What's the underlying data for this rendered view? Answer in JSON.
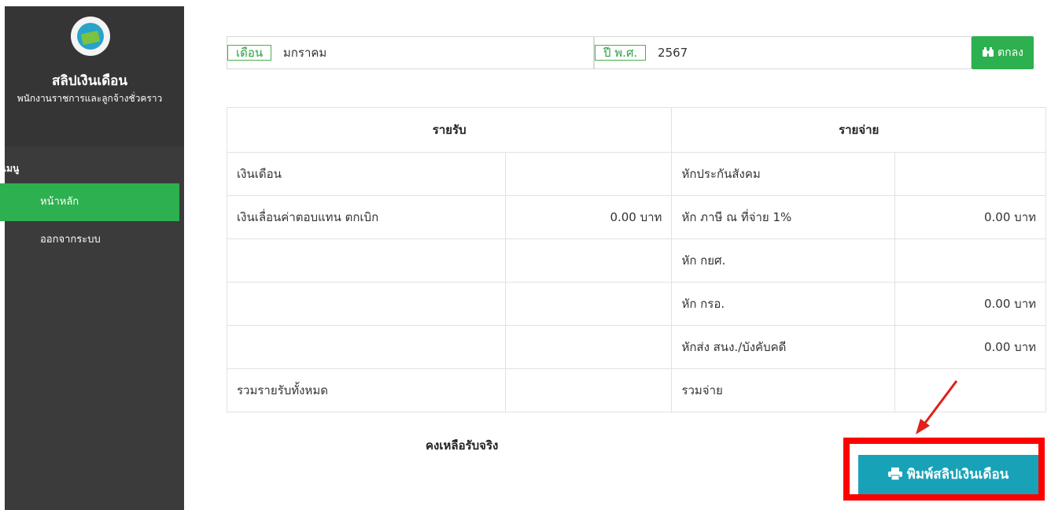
{
  "sidebar": {
    "app_title": "สลิปเงินเดือน",
    "app_subtitle": "พนักงานราชการและลูกจ้างชั่วคราว",
    "menu_header": "เมนู",
    "items": [
      {
        "label": "หน้าหลัก",
        "active": true
      },
      {
        "label": "ออกจากระบบ",
        "active": false
      }
    ]
  },
  "filter": {
    "month_label": "เดือน",
    "month_value": "มกราคม",
    "year_label": "ปี พ.ศ.",
    "year_value": "2567",
    "submit_label": "ตกลง",
    "submit_icon": "binoculars-icon"
  },
  "table": {
    "headers": {
      "income": "รายรับ",
      "expense": "รายจ่าย"
    },
    "rows": [
      {
        "income_label": "เงินเดือน",
        "income_amount": "",
        "expense_label": "หักประกันสังคม",
        "expense_amount": ""
      },
      {
        "income_label": "เงินเลื่อนค่าตอบแทน ตกเบิก",
        "income_amount": "0.00 บาท",
        "expense_label": "หัก ภาษี ณ ที่จ่าย 1%",
        "expense_amount": "0.00 บาท"
      },
      {
        "income_label": "",
        "income_amount": "",
        "expense_label": "หัก กยศ.",
        "expense_amount": ""
      },
      {
        "income_label": "",
        "income_amount": "",
        "expense_label": "หัก กรอ.",
        "expense_amount": "0.00 บาท"
      },
      {
        "income_label": "",
        "income_amount": "",
        "expense_label": "หักส่ง สนง./บังคับคดี",
        "expense_amount": "0.00 บาท"
      },
      {
        "income_label": "รวมรายรับทั้งหมด",
        "income_amount": "",
        "expense_label": "รวมจ่าย",
        "expense_amount": ""
      }
    ],
    "net_label": "คงเหลือรับจริง"
  },
  "print": {
    "label": "พิมพ์สลิปเงินเดือน",
    "icon": "printer-icon"
  },
  "colors": {
    "sidebar_bg": "#3b3b3b",
    "accent_green": "#2db04f",
    "print_button": "#17a2b8",
    "highlight_box": "#ff0000"
  }
}
